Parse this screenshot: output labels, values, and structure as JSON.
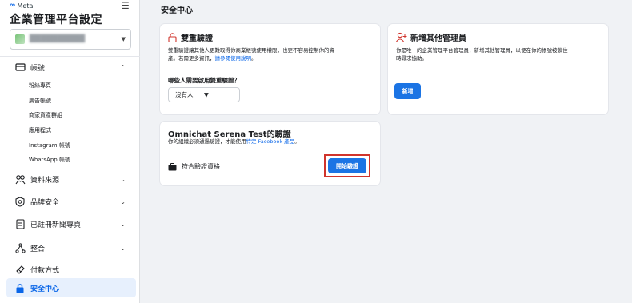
{
  "brand": {
    "logo_text": "Meta",
    "meta_symbol": "∞"
  },
  "sidebar": {
    "app_title": "企業管理平台設定",
    "account_name": "██████████",
    "sections": [
      {
        "label": "帳號",
        "icon": "account-icon",
        "expanded": true
      },
      {
        "label": "資料來源",
        "icon": "data-sources-icon"
      },
      {
        "label": "品牌安全",
        "icon": "brand-safety-icon"
      },
      {
        "label": "已註冊新聞專頁",
        "icon": "registered-news-pages-icon"
      },
      {
        "label": "整合",
        "icon": "integrations-icon"
      },
      {
        "label": "付款方式",
        "icon": "payment-methods-icon"
      },
      {
        "label": "安全中心",
        "icon": "lock-icon",
        "active": true
      }
    ],
    "account_items": [
      "粉絲專頁",
      "廣告帳號",
      "商家資產群組",
      "應用程式",
      "Instagram 帳號",
      "WhatsApp 帳號"
    ]
  },
  "main": {
    "title": "安全中心",
    "two_factor": {
      "title": "雙重驗證",
      "description_1": "雙重驗證讓其他人更難取得你商業帳號使用權限，也更不容易控制你的資",
      "description_2": "產。若需更多資訊，",
      "link": "請參閱使用說明",
      "period": "。",
      "question": "哪些人需要啟用雙重驗證？",
      "select_value": "沒有人"
    },
    "verification": {
      "title": "Omnichat Serena Test的驗證",
      "description": "你的組織必須通過驗證，才能使用",
      "link": "特定 Facebook 產品",
      "suffix": "。",
      "eligibility": "符合驗證資格",
      "button": "開始驗證"
    },
    "admins": {
      "title": "新增其他管理員",
      "description_1": "你是唯一的企業管理平台管理員，新增其他管理員，以便在你的帳號被鎖住",
      "description_2": "時尋求協助。",
      "button": "新增"
    }
  },
  "colors": {
    "accent": "#1b74e4",
    "highlight": "#d0342c",
    "active_bg": "#e7f0fd"
  }
}
